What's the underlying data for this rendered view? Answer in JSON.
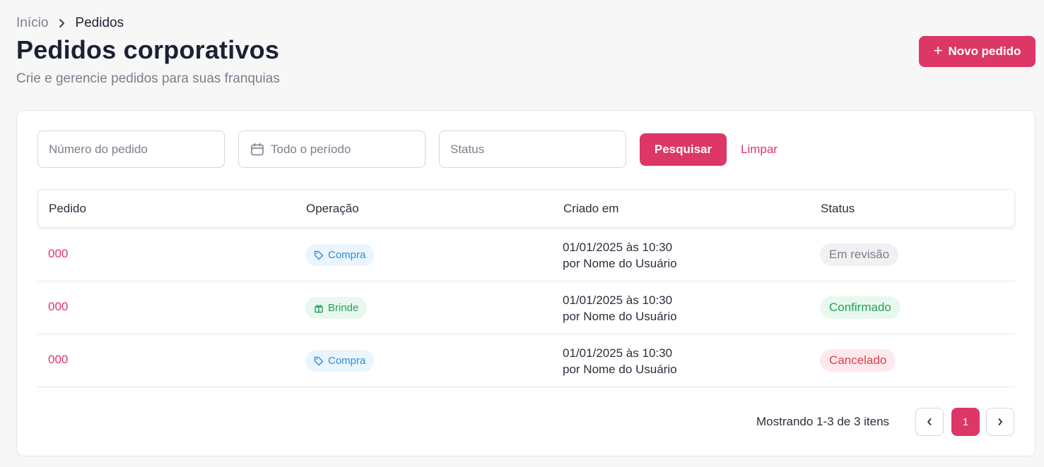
{
  "breadcrumb": {
    "home": "Início",
    "current": "Pedidos"
  },
  "page": {
    "title": "Pedidos corporativos",
    "subtitle": "Crie e gerencie pedidos para suas franquias",
    "new_button": "Novo pedido"
  },
  "filters": {
    "order_number_placeholder": "Número do pedido",
    "period_placeholder": "Todo o período",
    "status_placeholder": "Status",
    "search_label": "Pesquisar",
    "clear_label": "Limpar"
  },
  "table": {
    "headers": [
      "Pedido",
      "Operação",
      "Criado em",
      "Status"
    ],
    "rows": [
      {
        "order": "000",
        "operation": "Compra",
        "operation_icon": "tag-icon",
        "date": "01/01/2025 às 10:30",
        "by": "por Nome do Usuário",
        "status": "Em revisão"
      },
      {
        "order": "000",
        "operation": "Brinde",
        "operation_icon": "gift-icon",
        "date": "01/01/2025 às 10:30",
        "by": "por Nome do Usuário",
        "status": "Confirmado"
      },
      {
        "order": "000",
        "operation": "Compra",
        "operation_icon": "tag-icon",
        "date": "01/01/2025 às 10:30",
        "by": "por Nome do Usuário",
        "status": "Cancelado"
      }
    ]
  },
  "pagination": {
    "summary": "Mostrando 1-3 de 3 itens",
    "current_page": "1"
  },
  "colors": {
    "accent": "#dc3766",
    "compra": "#2f8fd8",
    "brinde": "#21a05a",
    "cancelado": "#d8434f"
  }
}
